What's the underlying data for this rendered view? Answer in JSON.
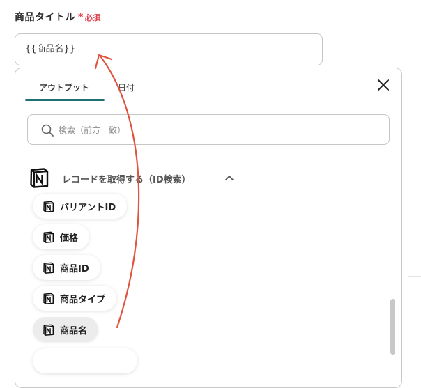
{
  "field": {
    "label": "商品タイトル",
    "required_mark": "*",
    "required_text": "必須",
    "value": "{{商品名}}"
  },
  "panel": {
    "tabs": [
      {
        "label": "アウトプット",
        "active": true
      },
      {
        "label": "日付",
        "active": false
      }
    ],
    "search_placeholder": "検索（前方一致）",
    "group": {
      "title": "レコードを取得する（ID検索）",
      "icon": "notion-logo",
      "expanded": true
    },
    "items": [
      {
        "label": "バリアントID",
        "icon": "notion-logo"
      },
      {
        "label": "価格",
        "icon": "notion-logo"
      },
      {
        "label": "商品ID",
        "icon": "notion-logo"
      },
      {
        "label": "商品タイプ",
        "icon": "notion-logo"
      },
      {
        "label": "商品名",
        "icon": "notion-logo",
        "active": true
      }
    ]
  },
  "colors": {
    "required": "#e0434f",
    "tab_underline": "#1f6f76",
    "arrow": "#e0533f"
  }
}
